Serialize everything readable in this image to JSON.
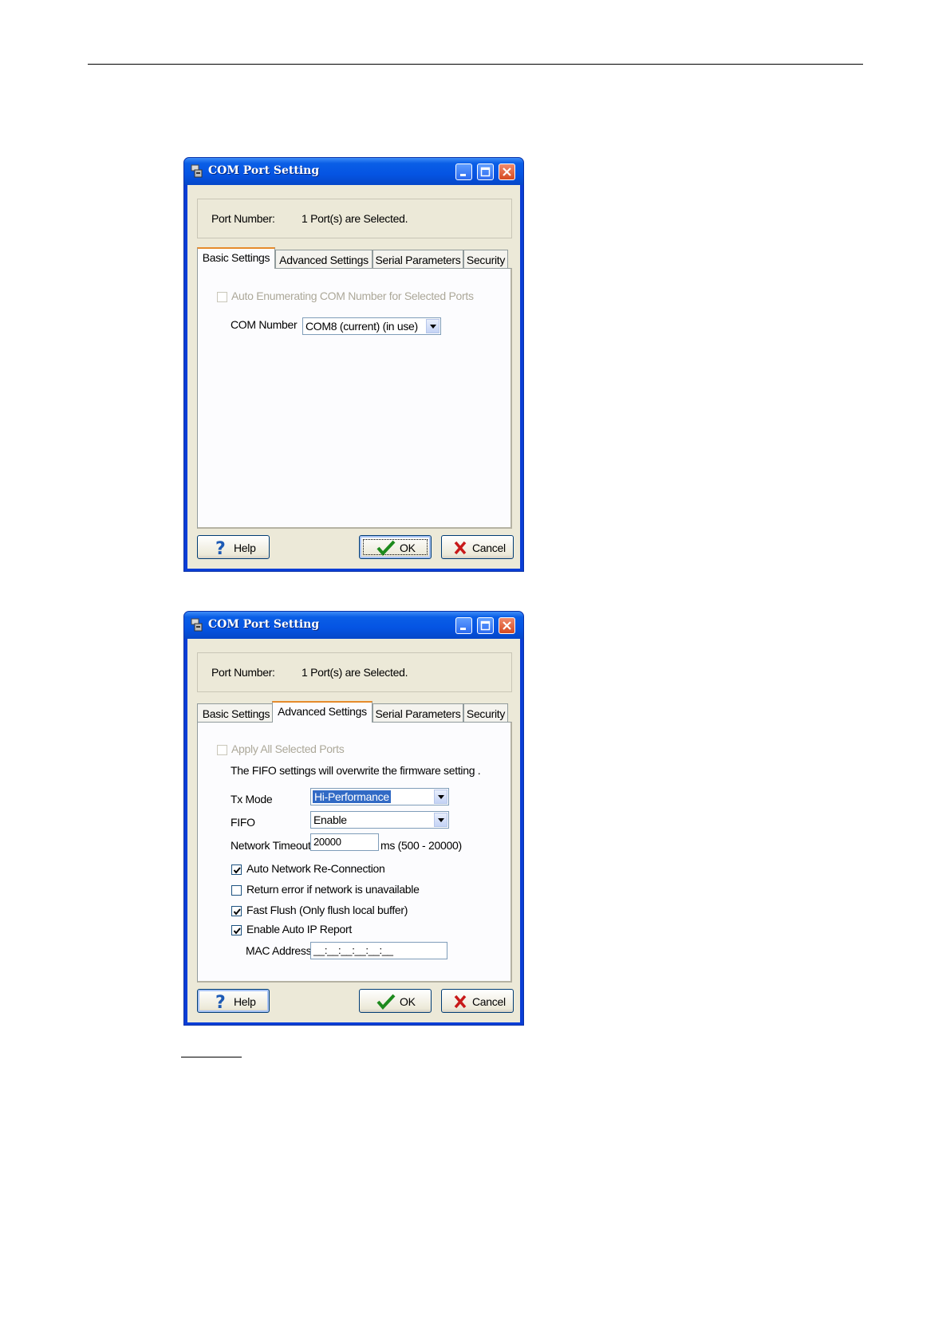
{
  "windows": [
    {
      "title": "COM Port Setting",
      "port_label": "Port Number:",
      "port_value": "1 Port(s) are Selected.",
      "tabs": [
        "Basic Settings",
        "Advanced Settings",
        "Serial Parameters",
        "Security"
      ],
      "active_tab": "Basic Settings",
      "auto_enum_label": "Auto Enumerating COM Number for Selected Ports",
      "auto_enum_checked": false,
      "com_number_label": "COM Number",
      "com_number_value": "COM8 (current) (in use)",
      "buttons": {
        "help": "Help",
        "ok": "OK",
        "cancel": "Cancel"
      }
    },
    {
      "title": "COM Port Setting",
      "port_label": "Port Number:",
      "port_value": "1 Port(s) are Selected.",
      "tabs": [
        "Basic Settings",
        "Advanced Settings",
        "Serial Parameters",
        "Security"
      ],
      "active_tab": "Advanced Settings",
      "apply_all_label": "Apply All Selected Ports",
      "apply_all_checked": false,
      "fifo_note": "The FIFO settings will overwrite the firmware setting .",
      "tx_mode_label": "Tx Mode",
      "tx_mode_value": "Hi-Performance",
      "fifo_label": "FIFO",
      "fifo_value": "Enable",
      "network_timeout_label": "Network Timeout",
      "network_timeout_value": "20000",
      "network_timeout_unit": "ms (500 - 20000)",
      "options": [
        {
          "label": "Auto Network Re-Connection",
          "checked": true
        },
        {
          "label": "Return error if network is unavailable",
          "checked": false
        },
        {
          "label": "Fast Flush (Only flush local buffer)",
          "checked": true
        },
        {
          "label": "Enable Auto IP Report",
          "checked": true
        }
      ],
      "mac_address_label": "MAC Address",
      "mac_address_value": "__:__:__:__:__:__",
      "buttons": {
        "help": "Help",
        "ok": "OK",
        "cancel": "Cancel"
      }
    }
  ],
  "icons": {
    "app": "com-port-app-icon",
    "minimize": "minimize-icon",
    "maximize": "maximize-icon",
    "close": "close-icon",
    "help": "question-mark-icon",
    "ok": "checkmark-icon",
    "cancel": "red-x-icon"
  },
  "colors": {
    "titlebar": "#0554e3",
    "dialog_face": "#ece9d8",
    "active_tab_accent": "#e68b2c",
    "selection": "#316ac5"
  }
}
